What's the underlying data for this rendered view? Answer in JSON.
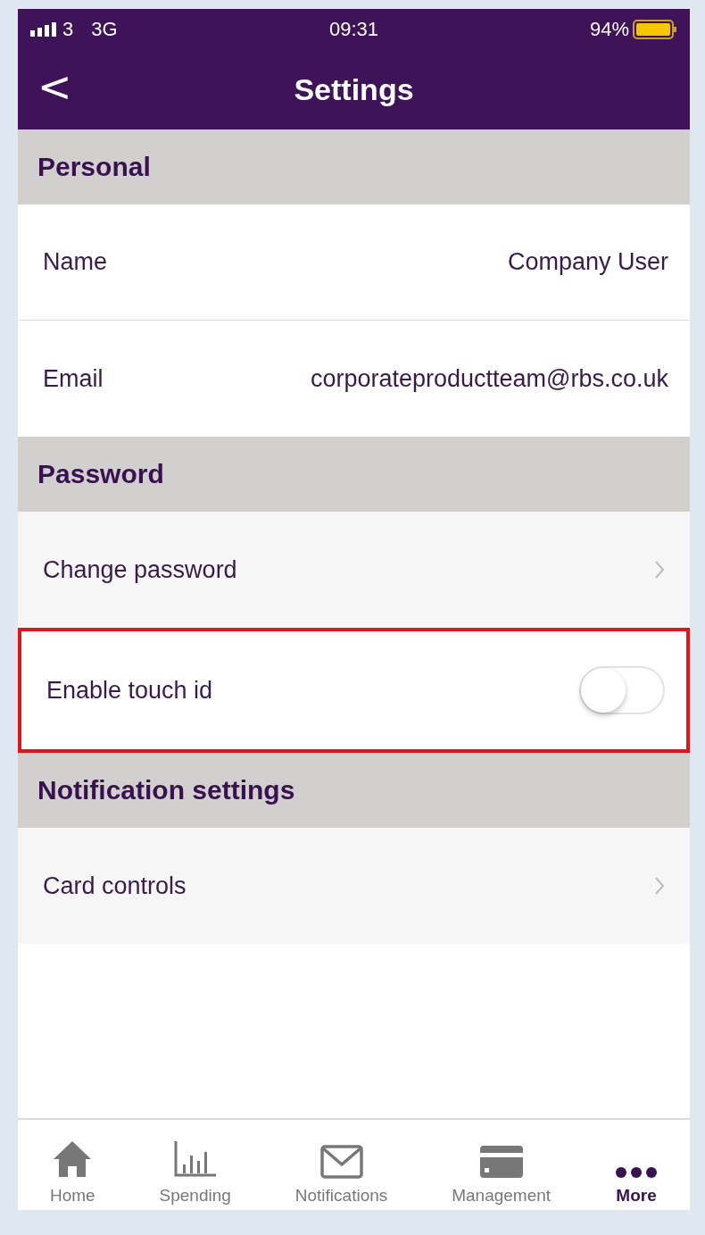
{
  "status_bar": {
    "carrier": "3",
    "network": "3G",
    "time": "09:31",
    "battery": "94%"
  },
  "header": {
    "back": "<",
    "title": "Settings"
  },
  "sections": [
    {
      "title": "Personal",
      "rows": [
        {
          "kind": "value",
          "label": "Name",
          "value": "Company User",
          "highlighted": false
        },
        {
          "kind": "value",
          "label": "Email",
          "value": "corporateproductteam@rbs.co.uk",
          "highlighted": false
        }
      ]
    },
    {
      "title": "Password",
      "rows": [
        {
          "kind": "link",
          "label": "Change password",
          "highlighted": false
        },
        {
          "kind": "toggle",
          "label": "Enable touch id",
          "on": false,
          "highlighted": true
        }
      ]
    },
    {
      "title": "Notification settings",
      "rows": [
        {
          "kind": "link",
          "label": "Card controls",
          "highlighted": false
        }
      ]
    }
  ],
  "tab_bar": [
    {
      "label": "Home",
      "selected": false
    },
    {
      "label": "Spending",
      "selected": false
    },
    {
      "label": "Notifications",
      "selected": false
    },
    {
      "label": "Management",
      "selected": false
    },
    {
      "label": "More",
      "selected": true
    }
  ]
}
